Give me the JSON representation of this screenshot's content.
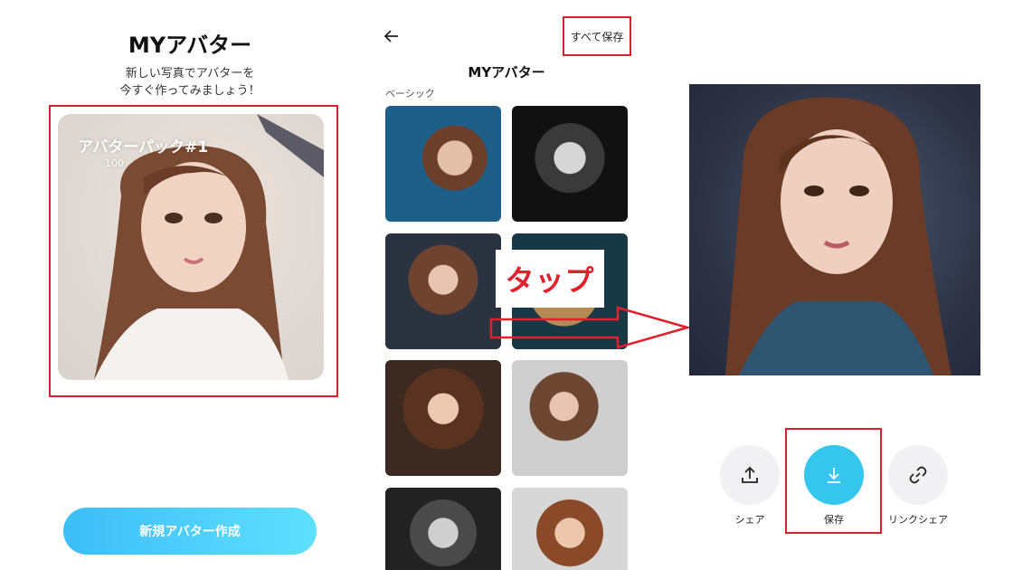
{
  "panel1": {
    "title": "MYアバター",
    "subtitle_line1": "新しい写真でアバターを",
    "subtitle_line2": "今すぐ作ってみましょう！",
    "card_title": "アバターパック#1",
    "card_count": "100",
    "create_button": "新規アバター作成"
  },
  "panel2": {
    "back_icon": "arrow-left-icon",
    "save_all": "すべて保存",
    "title": "MYアバター",
    "section_label": "ベーシック",
    "annotation": "タップ"
  },
  "panel3": {
    "actions": [
      {
        "label": "シェア",
        "icon": "upload-icon"
      },
      {
        "label": "保存",
        "icon": "download-icon"
      },
      {
        "label": "リンクシェア",
        "icon": "link-icon"
      }
    ]
  },
  "colors": {
    "accent": "#35c6ee",
    "highlight_red": "#d92030",
    "annotation_red": "#e0202a"
  }
}
